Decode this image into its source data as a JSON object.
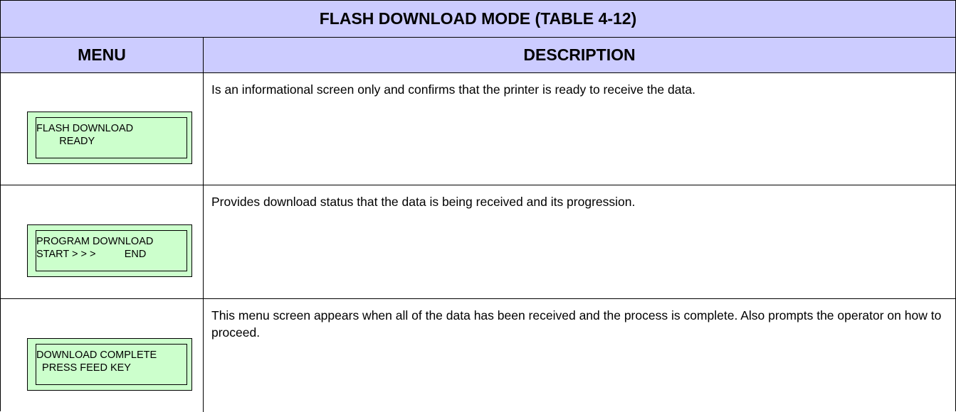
{
  "table": {
    "title": "FLASH DOWNLOAD MODE (TABLE 4-12)",
    "header": {
      "menu": "MENU",
      "description": "DESCRIPTION"
    },
    "rows": [
      {
        "lcd_line1": "FLASH DOWNLOAD",
        "lcd_line2": "        READY",
        "description": "Is an informational screen only and confirms that the printer is ready to receive the data."
      },
      {
        "lcd_line1": "PROGRAM DOWNLOAD",
        "lcd_line2": "START > > >          END",
        "description": "Provides download status that the data is being received and its progression."
      },
      {
        "lcd_line1": "DOWNLOAD COMPLETE",
        "lcd_line2": "  PRESS FEED KEY",
        "description": "This menu screen appears when all of the data has been received and the process is complete. Also prompts the operator on how to proceed."
      }
    ]
  },
  "colors": {
    "header_background": "#ccccff",
    "lcd_background": "#ccffcc",
    "border": "#000000"
  }
}
